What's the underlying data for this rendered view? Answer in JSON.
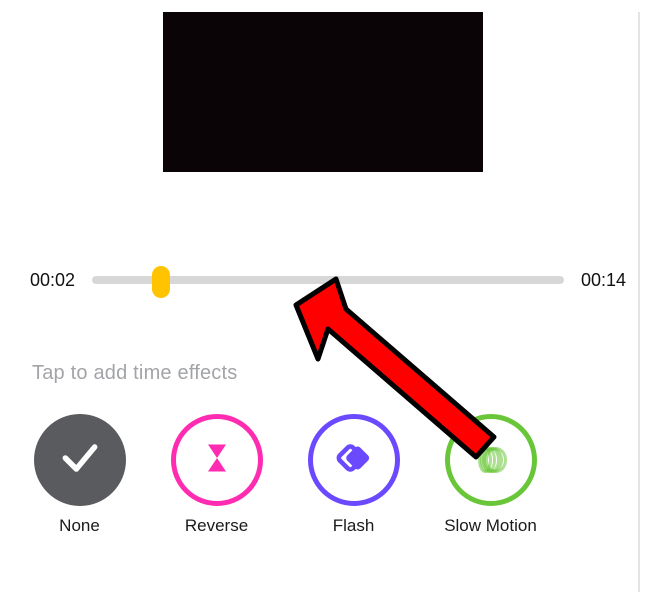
{
  "timeline": {
    "current_time": "00:02",
    "total_time": "00:14"
  },
  "hint": "Tap to add time effects",
  "effects": [
    {
      "label": "None"
    },
    {
      "label": "Reverse"
    },
    {
      "label": "Flash"
    },
    {
      "label": "Slow Motion"
    }
  ],
  "colors": {
    "reverse": "#ff2bb1",
    "flash": "#6a49ff",
    "slow": "#6ac639"
  }
}
